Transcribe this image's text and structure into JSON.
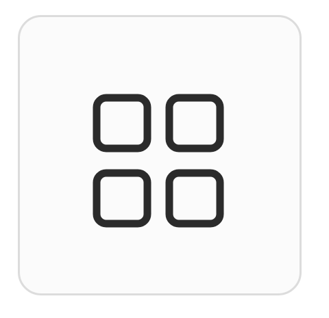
{
  "tile": {
    "icon": "grid-icon",
    "label": ""
  },
  "colors": {
    "icon_stroke": "#2b2b2b",
    "tile_background": "#fbfbfb",
    "tile_border": "#dcdcdc"
  }
}
